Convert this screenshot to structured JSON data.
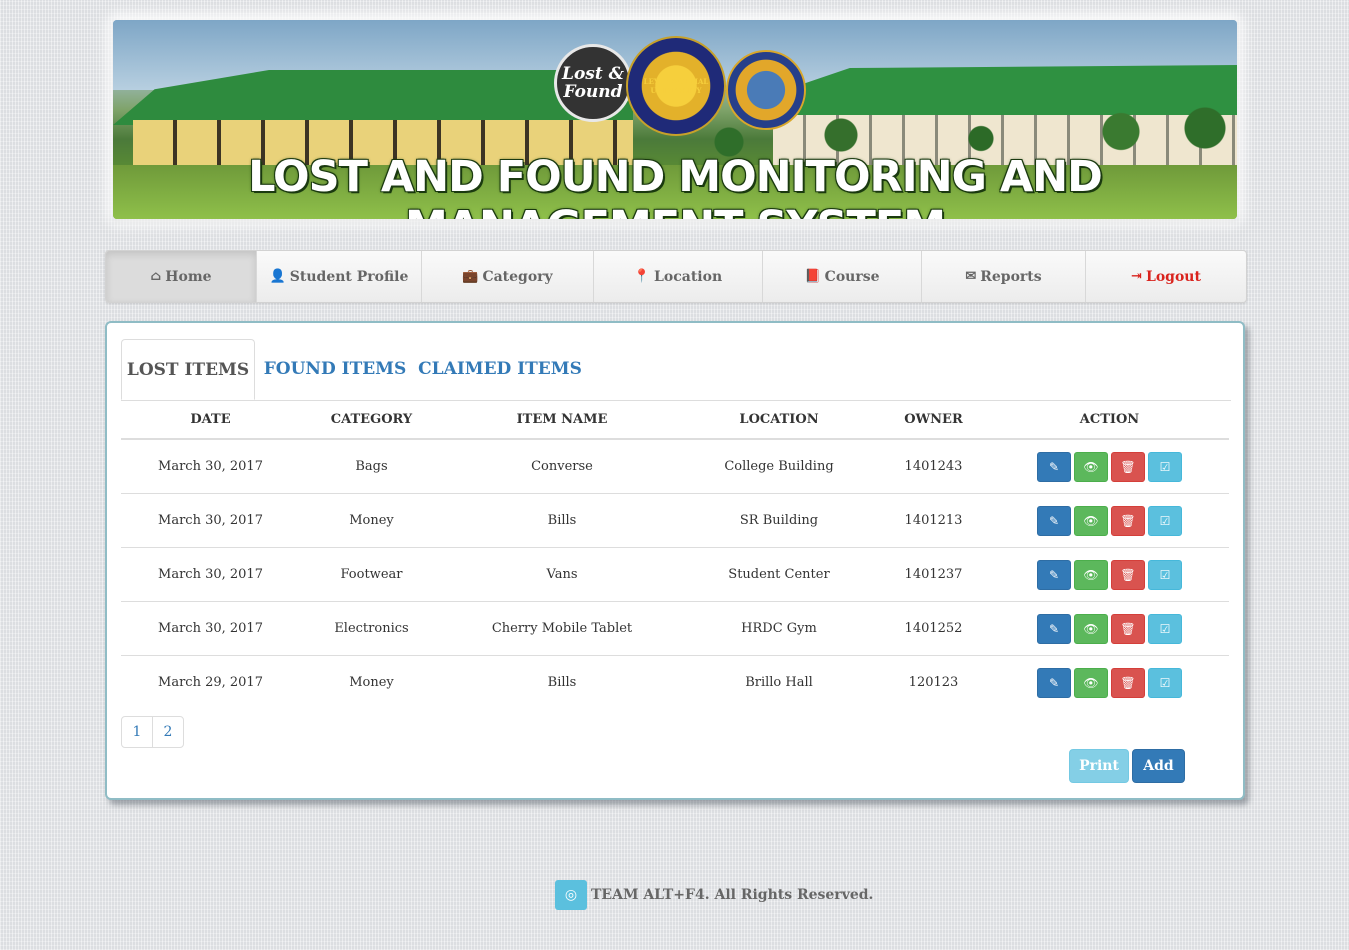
{
  "header": {
    "banner_title": "LOST AND FOUND MONITORING AND MANAGEMENT SYSTEM",
    "logo_text": "Lost & Found",
    "university_seal_text": "LEYTE NORMAL UNIVERSITY"
  },
  "navbar": {
    "items": [
      {
        "label": "Home",
        "icon": "home-icon",
        "glyph": "⌂"
      },
      {
        "label": "Student Profile",
        "icon": "user-icon",
        "glyph": "👤"
      },
      {
        "label": "Category",
        "icon": "briefcase-icon",
        "glyph": "💼"
      },
      {
        "label": "Location",
        "icon": "map-marker-icon",
        "glyph": "📍"
      },
      {
        "label": "Course",
        "icon": "book-icon",
        "glyph": "📕"
      },
      {
        "label": "Reports",
        "icon": "envelope-icon",
        "glyph": "✉"
      },
      {
        "label": "Logout",
        "icon": "logout-icon",
        "glyph": "⇥"
      }
    ]
  },
  "tabs": [
    {
      "label": "LOST ITEMS",
      "active": true
    },
    {
      "label": "FOUND ITEMS",
      "active": false
    },
    {
      "label": "CLAIMED ITEMS",
      "active": false
    }
  ],
  "table": {
    "headers": [
      "DATE",
      "CATEGORY",
      "ITEM NAME",
      "LOCATION",
      "OWNER",
      "ACTION"
    ],
    "rows": [
      {
        "date": "March 30, 2017",
        "category": "Bags",
        "item": "Converse",
        "location": "College Building",
        "owner": "1401243"
      },
      {
        "date": "March 30, 2017",
        "category": "Money",
        "item": "Bills",
        "location": "SR Building",
        "owner": "1401213"
      },
      {
        "date": "March 30, 2017",
        "category": "Footwear",
        "item": "Vans",
        "location": "Student Center",
        "owner": "1401237"
      },
      {
        "date": "March 30, 2017",
        "category": "Electronics",
        "item": "Cherry Mobile Tablet",
        "location": "HRDC Gym",
        "owner": "1401252"
      },
      {
        "date": "March 29, 2017",
        "category": "Money",
        "item": "Bills",
        "location": "Brillo Hall",
        "owner": "120123"
      }
    ]
  },
  "pagination": [
    "1",
    "2"
  ],
  "buttons": {
    "print": "Print",
    "add": "Add"
  },
  "footer": {
    "text": "TEAM ALT+F4. All Rights Reserved.",
    "badge_glyph": "◎"
  },
  "colors": {
    "primary": "#337ab7",
    "success": "#5cb85c",
    "danger": "#d9534f",
    "info": "#5bc0de",
    "logout": "#d9231d",
    "panel_border": "#8fbcc5"
  }
}
